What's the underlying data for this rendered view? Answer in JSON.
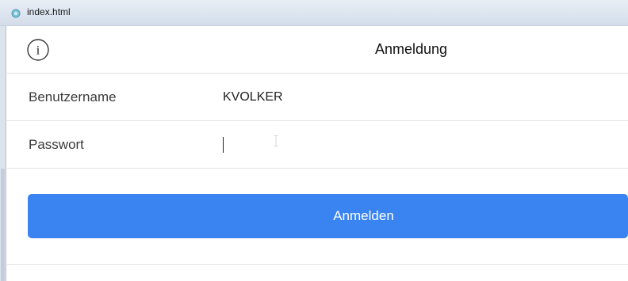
{
  "window": {
    "tab_title": "index.html"
  },
  "header": {
    "title": "Anmeldung",
    "info_icon": "info-circle-icon"
  },
  "form": {
    "username_label": "Benutzername",
    "username_value": "KVOLKER",
    "password_label": "Passwort",
    "password_value": ""
  },
  "actions": {
    "login_label": "Anmelden"
  },
  "colors": {
    "primary_button": "#3a84f2",
    "divider": "#e2e2e2"
  }
}
